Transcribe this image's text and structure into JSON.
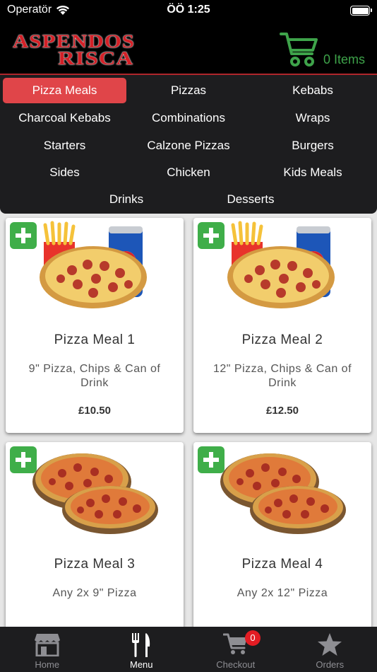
{
  "status_bar": {
    "carrier": "Operatör",
    "time": "ÖÖ 1:25"
  },
  "header": {
    "logo_line1": "ASPENDOS",
    "logo_line2": "RISCA",
    "cart_label": "0 Items",
    "accent_color": "#3ea34a"
  },
  "categories": [
    {
      "label": "Pizza Meals",
      "active": true
    },
    {
      "label": "Pizzas"
    },
    {
      "label": "Kebabs"
    },
    {
      "label": "Charcoal Kebabs"
    },
    {
      "label": "Combinations"
    },
    {
      "label": "Wraps"
    },
    {
      "label": "Starters"
    },
    {
      "label": "Calzone Pizzas"
    },
    {
      "label": "Burgers"
    },
    {
      "label": "Sides"
    },
    {
      "label": "Chicken"
    },
    {
      "label": "Kids Meals"
    },
    {
      "label": "Drinks"
    },
    {
      "label": "Desserts"
    }
  ],
  "products": [
    {
      "name": "Pizza Meal 1",
      "description": "9\" Pizza, Chips & Can of Drink",
      "price": "£10.50",
      "image": "pizza-chips-drink"
    },
    {
      "name": "Pizza Meal 2",
      "description": "12\" Pizza, Chips & Can of Drink",
      "price": "£12.50",
      "image": "pizza-chips-drink"
    },
    {
      "name": "Pizza Meal 3",
      "description": "Any 2x 9\" Pizza",
      "price": "",
      "image": "two-pizzas"
    },
    {
      "name": "Pizza Meal 4",
      "description": "Any 2x 12\" Pizza",
      "price": "",
      "image": "two-pizzas"
    }
  ],
  "tabbar": {
    "home": "Home",
    "menu": "Menu",
    "checkout": "Checkout",
    "checkout_badge": "0",
    "orders": "Orders"
  },
  "colors": {
    "active_category": "#e04549",
    "add_button": "#3fae49",
    "badge": "#e31c23"
  }
}
